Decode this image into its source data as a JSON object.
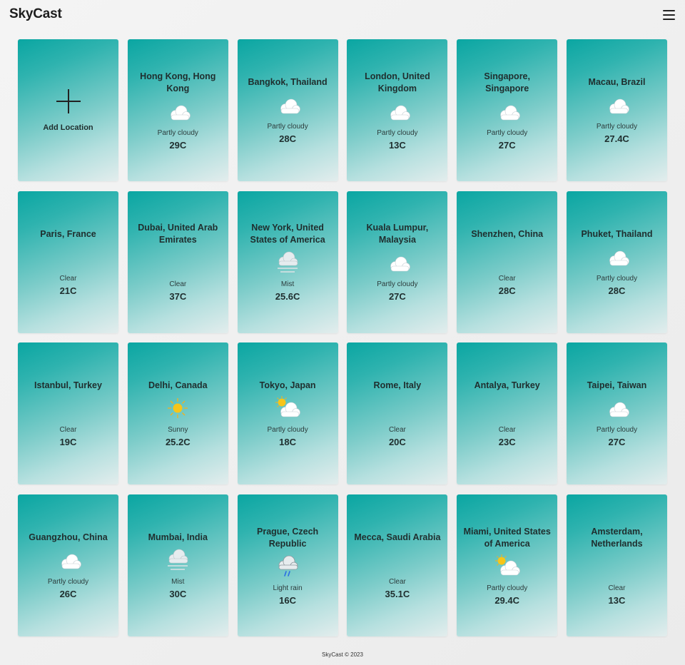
{
  "app": {
    "title": "SkyCast"
  },
  "header": {
    "menu_icon": "hamburger-menu-icon"
  },
  "add_card": {
    "label": "Add Location",
    "icon": "plus-icon"
  },
  "cities": [
    {
      "name": "Hong Kong, Hong Kong",
      "condition": "Partly cloudy",
      "temp": "29C",
      "icon": "moon-cloud"
    },
    {
      "name": "Bangkok, Thailand",
      "condition": "Partly cloudy",
      "temp": "28C",
      "icon": "moon-cloud"
    },
    {
      "name": "London, United Kingdom",
      "condition": "Partly cloudy",
      "temp": "13C",
      "icon": "moon-cloud"
    },
    {
      "name": "Singapore, Singapore",
      "condition": "Partly cloudy",
      "temp": "27C",
      "icon": "moon-cloud"
    },
    {
      "name": "Macau, Brazil",
      "condition": "Partly cloudy",
      "temp": "27.4C",
      "icon": "moon-cloud"
    },
    {
      "name": "Paris, France",
      "condition": "Clear",
      "temp": "21C",
      "icon": "moon"
    },
    {
      "name": "Dubai, United Arab Emirates",
      "condition": "Clear",
      "temp": "37C",
      "icon": "moon"
    },
    {
      "name": "New York, United States of America",
      "condition": "Mist",
      "temp": "25.6C",
      "icon": "mist"
    },
    {
      "name": "Kuala Lumpur, Malaysia",
      "condition": "Partly cloudy",
      "temp": "27C",
      "icon": "moon-cloud"
    },
    {
      "name": "Shenzhen, China",
      "condition": "Clear",
      "temp": "28C",
      "icon": "moon"
    },
    {
      "name": "Phuket, Thailand",
      "condition": "Partly cloudy",
      "temp": "28C",
      "icon": "moon-cloud"
    },
    {
      "name": "Istanbul, Turkey",
      "condition": "Clear",
      "temp": "19C",
      "icon": "moon"
    },
    {
      "name": "Delhi, Canada",
      "condition": "Sunny",
      "temp": "25.2C",
      "icon": "sun"
    },
    {
      "name": "Tokyo, Japan",
      "condition": "Partly cloudy",
      "temp": "18C",
      "icon": "sun-cloud"
    },
    {
      "name": "Rome, Italy",
      "condition": "Clear",
      "temp": "20C",
      "icon": "moon"
    },
    {
      "name": "Antalya, Turkey",
      "condition": "Clear",
      "temp": "23C",
      "icon": "moon"
    },
    {
      "name": "Taipei, Taiwan",
      "condition": "Partly cloudy",
      "temp": "27C",
      "icon": "moon-cloud"
    },
    {
      "name": "Guangzhou, China",
      "condition": "Partly cloudy",
      "temp": "26C",
      "icon": "moon-cloud"
    },
    {
      "name": "Mumbai, India",
      "condition": "Mist",
      "temp": "30C",
      "icon": "mist"
    },
    {
      "name": "Prague, Czech Republic",
      "condition": "Light rain",
      "temp": "16C",
      "icon": "rain-cloud"
    },
    {
      "name": "Mecca, Saudi Arabia",
      "condition": "Clear",
      "temp": "35.1C",
      "icon": "moon"
    },
    {
      "name": "Miami, United States of America",
      "condition": "Partly cloudy",
      "temp": "29.4C",
      "icon": "sun-cloud"
    },
    {
      "name": "Amsterdam, Netherlands",
      "condition": "Clear",
      "temp": "13C",
      "icon": "moon"
    }
  ],
  "footer": {
    "text": "SkyCast © 2023"
  }
}
